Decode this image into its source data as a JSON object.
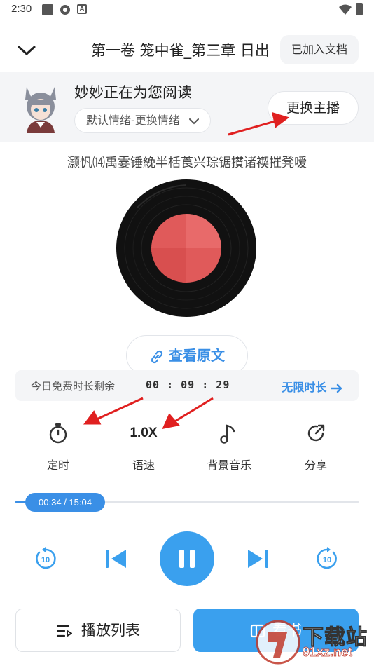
{
  "status_bar": {
    "time": "2:30",
    "icons": [
      "square-icon",
      "gear-icon",
      "a-box-icon",
      "wifi-icon",
      "battery-icon"
    ]
  },
  "header": {
    "title": "第一卷 笼中雀_第三章 日出",
    "added_doc_label": "已加入文档",
    "back_icon": "chevron-down-icon"
  },
  "anchor": {
    "name": "妙妙正在为您阅读",
    "emotion_label": "默认情绪-更换情绪",
    "change_button": "更换主播"
  },
  "garbled_text": "灏忛⒁禹霎锤絻半栝莨兴琮锯攅诸褉摧凳嗳",
  "view_original": "查看原文",
  "free_time": {
    "label": "今日免费时长剩余",
    "remaining": "00 : 09 : 29",
    "unlimited_label": "无限时长"
  },
  "controls": [
    {
      "icon": "timer-icon",
      "label": "定时"
    },
    {
      "icon": "speed-text",
      "value": "1.0X",
      "label": "语速"
    },
    {
      "icon": "music-note-icon",
      "label": "背景音乐"
    },
    {
      "icon": "share-icon",
      "label": "分享"
    }
  ],
  "progress": {
    "display": "00:34 / 15:04",
    "fraction": 0.038
  },
  "playback": {
    "rewind_seconds": "10",
    "forward_seconds": "10",
    "state": "playing"
  },
  "bottom": {
    "playlist_label": "播放列表",
    "read_label": "看书"
  },
  "watermark": {
    "line1": "下载站",
    "line2": "91xz.net"
  },
  "colors": {
    "accent": "#3a8fe6",
    "play_button": "#3aa0ee",
    "annotation_arrow": "#e02020",
    "record_label": "#e05a5a"
  }
}
